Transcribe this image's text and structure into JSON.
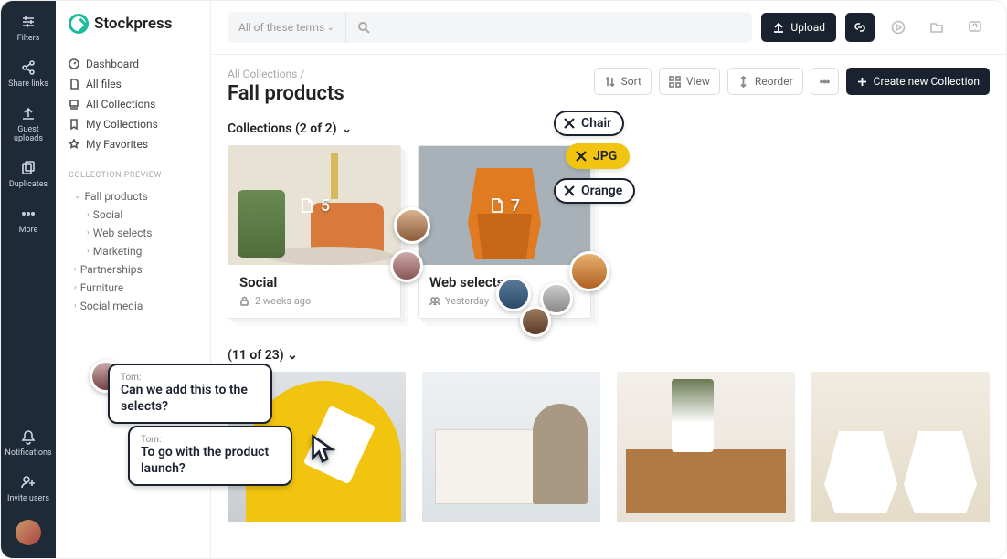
{
  "brand": "Stockpress",
  "rail": {
    "filters": "Filters",
    "share": "Share links",
    "guest": "Guest\nuploads",
    "duplicates": "Duplicates",
    "more": "More",
    "notifications": "Notifications",
    "invite": "Invite users"
  },
  "nav": {
    "dashboard": "Dashboard",
    "allfiles": "All files",
    "allcollections": "All Collections",
    "mycollections": "My Collections",
    "favorites": "My Favorites"
  },
  "preview": {
    "title": "COLLECTION PREVIEW",
    "root": "Fall products",
    "children": [
      "Social",
      "Web selects",
      "Marketing"
    ],
    "siblings": [
      "Partnerships",
      "Furniture",
      "Social media"
    ]
  },
  "search": {
    "terms": "All of these terms"
  },
  "toolbar": {
    "upload": "Upload"
  },
  "breadcrumb": "All Collections /",
  "page_title": "Fall products",
  "actions": {
    "sort": "Sort",
    "view": "View",
    "reorder": "Reorder",
    "create": "Create new Collection"
  },
  "collections_head": "Collections (2 of 2)",
  "cards": [
    {
      "title": "Social",
      "count": "5",
      "meta": "2 weeks ago",
      "meta_icon": "lock"
    },
    {
      "title": "Web selects",
      "count": "7",
      "meta": "Yesterday",
      "meta_icon": "users"
    }
  ],
  "tags": {
    "chair": "Chair",
    "jpg": "JPG",
    "orange": "Orange"
  },
  "files_head": "(11 of 23)",
  "comments": [
    {
      "who": "Tom:",
      "text": "Can we add this to the selects?"
    },
    {
      "who": "Tom:",
      "text": "To go with the product launch?"
    }
  ]
}
